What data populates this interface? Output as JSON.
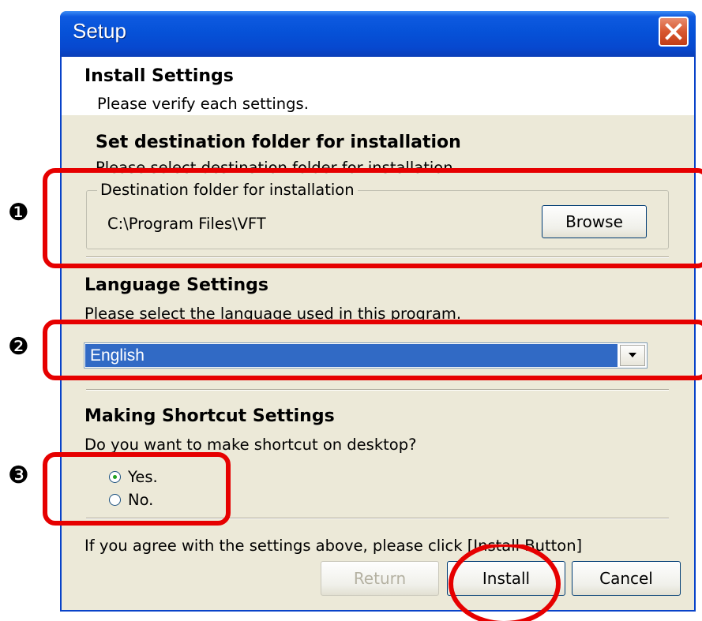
{
  "window": {
    "title": "Setup"
  },
  "header": {
    "title": "Install Settings",
    "subtitle": "Please verify each settings."
  },
  "destination": {
    "heading": "Set destination folder for installation",
    "description": "Please select destination folder for installation.",
    "group_label": "Destination folder for installation",
    "path": "C:\\Program Files\\VFT",
    "browse_label": "Browse"
  },
  "language": {
    "heading": "Language Settings",
    "description": "Please select the language used in this program.",
    "selected": "English"
  },
  "shortcut": {
    "heading": "Making Shortcut Settings",
    "question": "Do you want to make shortcut on desktop?",
    "options": [
      {
        "label": "Yes.",
        "checked": true
      },
      {
        "label": "No.",
        "checked": false
      }
    ]
  },
  "footer": {
    "instruction": "If you agree with the settings above, please click [Install Button]",
    "return_label": "Return",
    "install_label": "Install",
    "cancel_label": "Cancel"
  },
  "annotations": {
    "marker_1": "❶",
    "marker_2": "❷",
    "marker_3": "❸",
    "color": "#e60000"
  },
  "colors": {
    "titlebar": "#0652d8",
    "dialog_bg": "#ece9d8",
    "selection": "#316ac5"
  },
  "icons": {
    "close": "close-icon",
    "dropdown": "chevron-down-icon"
  }
}
